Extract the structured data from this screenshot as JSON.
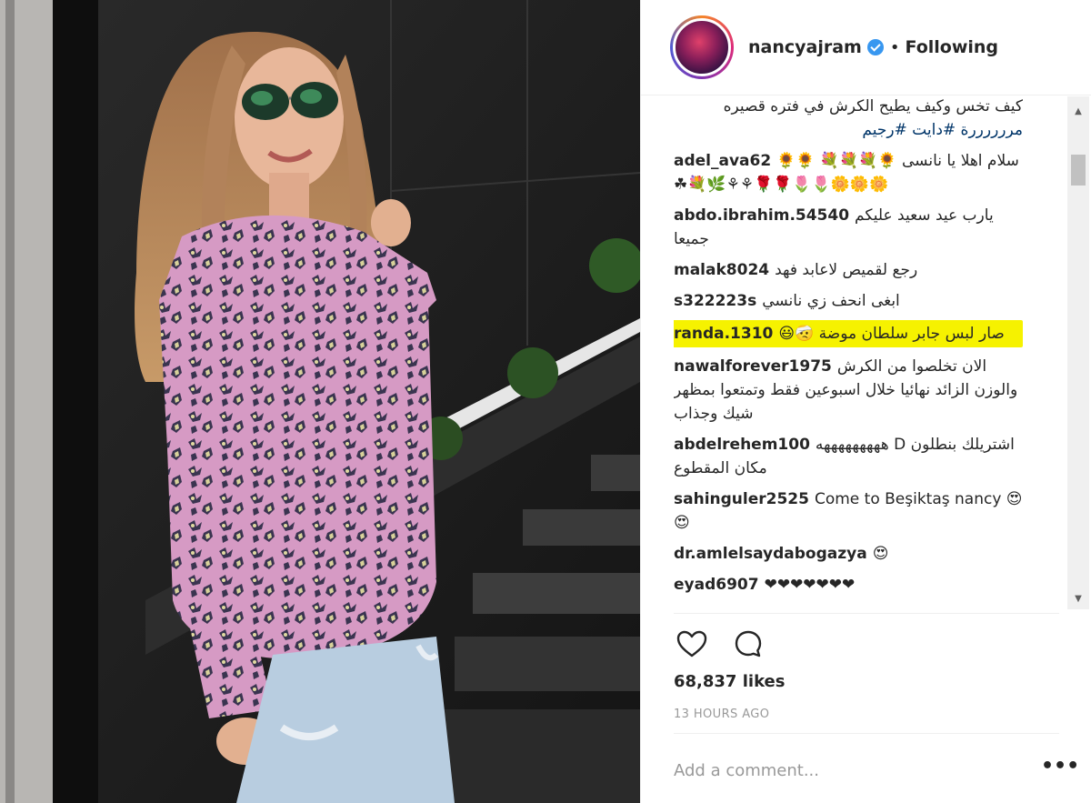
{
  "header": {
    "username": "nancyajram",
    "separator": "•",
    "follow_status": "Following"
  },
  "comments": [
    {
      "user": "",
      "lines": [
        "كيف تخس وكيف يطيح الكرش في فتره قصيره",
        "مررررررة #دايت #رجيم"
      ]
    },
    {
      "user": "adel_ava62",
      "text": "سلام اهلا يا نانسى 🌻💐💐💐 🌻🌻🌼🌼🌼🌷🌷🌹🌹⚘⚘🌿💐☘",
      "highlighted": false
    },
    {
      "user": "abdo.ibrahim.54540",
      "text": "يارب عيد سعيد عليكم جميعا",
      "highlighted": false
    },
    {
      "user": "malak8024",
      "text": "رجع لقميص لاعابد فهد",
      "highlighted": false
    },
    {
      "user": "s322223s",
      "text": "ابغى انحف زي نانسي",
      "highlighted": false
    },
    {
      "user": "randa.1310",
      "text": "صار لبس جابر سلطان موضة 🤕😃",
      "highlighted": true
    },
    {
      "user": "nawalforever1975",
      "text": "الان تخلصوا من الكرش والوزن الزائد نهائيا خلال اسبوعين فقط وتمتعوا بمظهر شيك وجذاب",
      "highlighted": false
    },
    {
      "user": "abdelrehem100",
      "text": "اشتريلك بنطلون D هههههههههه مكان المقطوع",
      "highlighted": false
    },
    {
      "user": "sahinguler2525",
      "text": "Come to Beşiktaş nancy 😍😍",
      "highlighted": false
    },
    {
      "user": "dr.amlelsaydabogazya",
      "text": "😍",
      "highlighted": false
    },
    {
      "user": "eyad6907",
      "text": "❤❤❤❤❤❤❤",
      "highlighted": false
    }
  ],
  "post": {
    "likes": "68,837 likes",
    "time": "13 HOURS AGO",
    "comment_placeholder": "Add a comment...",
    "more_label": "•••"
  },
  "icons": {
    "like": "heart-icon",
    "comment": "comment-bubble-icon",
    "verified": "verified-badge-icon",
    "more": "more-options-icon"
  },
  "colors": {
    "highlight": "#f6f200",
    "verified": "#3897f0",
    "hashtag": "#003569"
  }
}
